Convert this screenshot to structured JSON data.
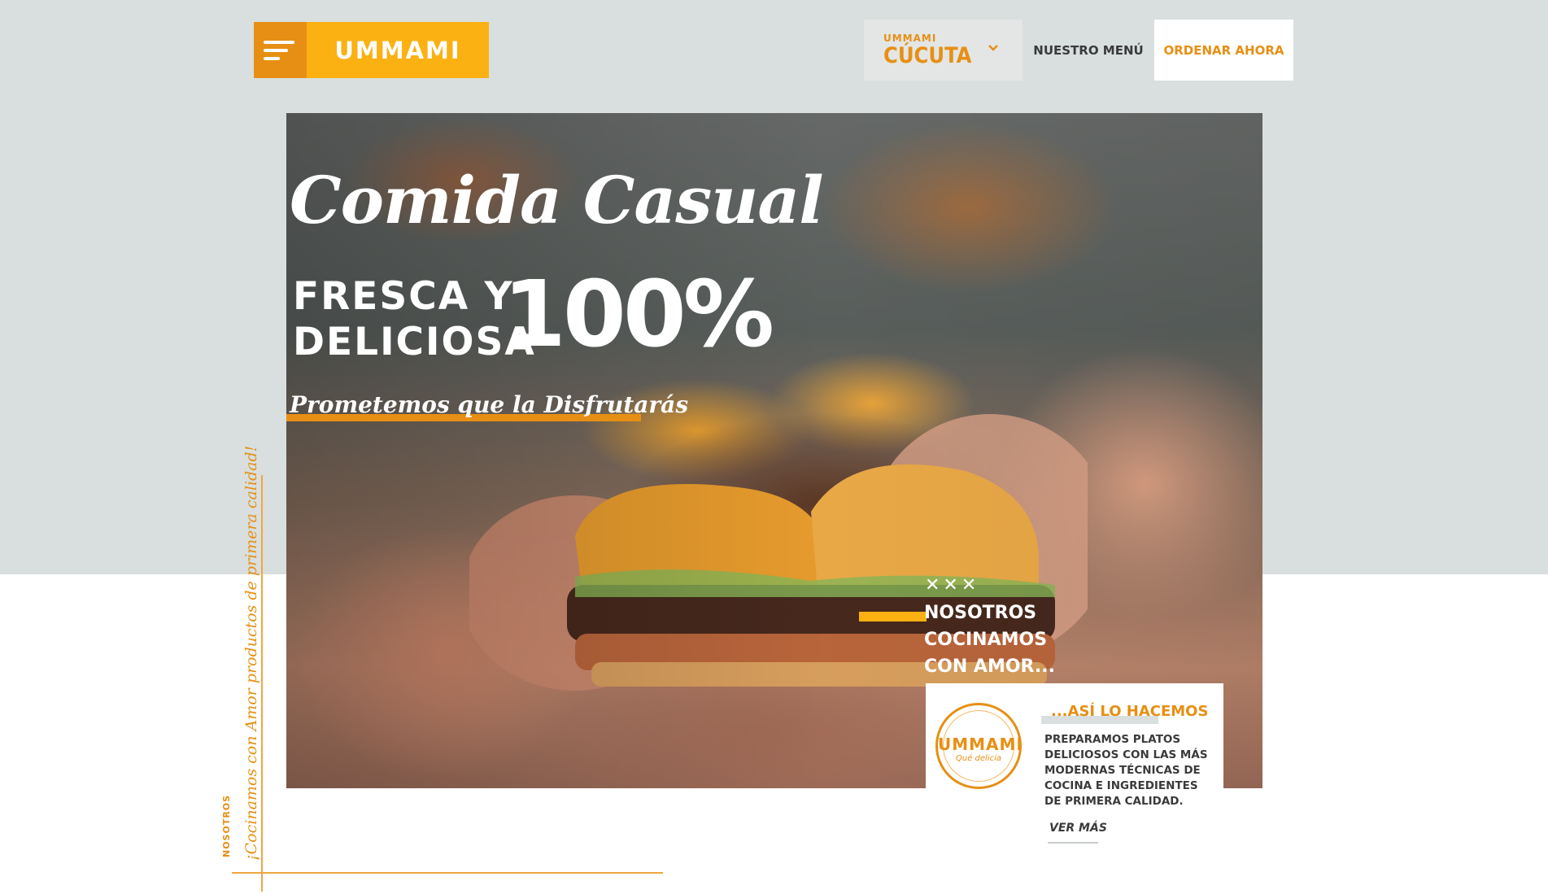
{
  "brand": {
    "logo_text": "UMMAMI",
    "accent_color": "#fbb111",
    "accent_dark": "#e78f14"
  },
  "nav": {
    "location_small": "UMMAMI",
    "location_city": "CÚCUTA",
    "menu_label": "NUESTRO MENÚ",
    "order_label": "ORDENAR AHORA"
  },
  "hero": {
    "title": "Comida Casual",
    "line1": "FRESCA Y",
    "line2": "DELICIOSA",
    "percent": "100%",
    "promise": "Prometemos que la Disfrutarás"
  },
  "nosotros": {
    "icons": "✕✕✕",
    "title": "NOSOTROS COCINAMOS CON AMOR...",
    "card_title": "...ASÍ LO HACEMOS",
    "card_body": "PREPARAMOS PLATOS DELICIOSOS CON LAS MÁS MODERNAS TÉCNICAS DE COCINA E INGREDIENTES DE PRIMERA CALIDAD.",
    "more_link": "VER MÁS",
    "badge_text": "UMMAMI",
    "badge_sub": "Qué delicia"
  },
  "side": {
    "label": "NOSOTROS",
    "text": "¡Cocinamos con Amor productos de primera calidad!"
  }
}
